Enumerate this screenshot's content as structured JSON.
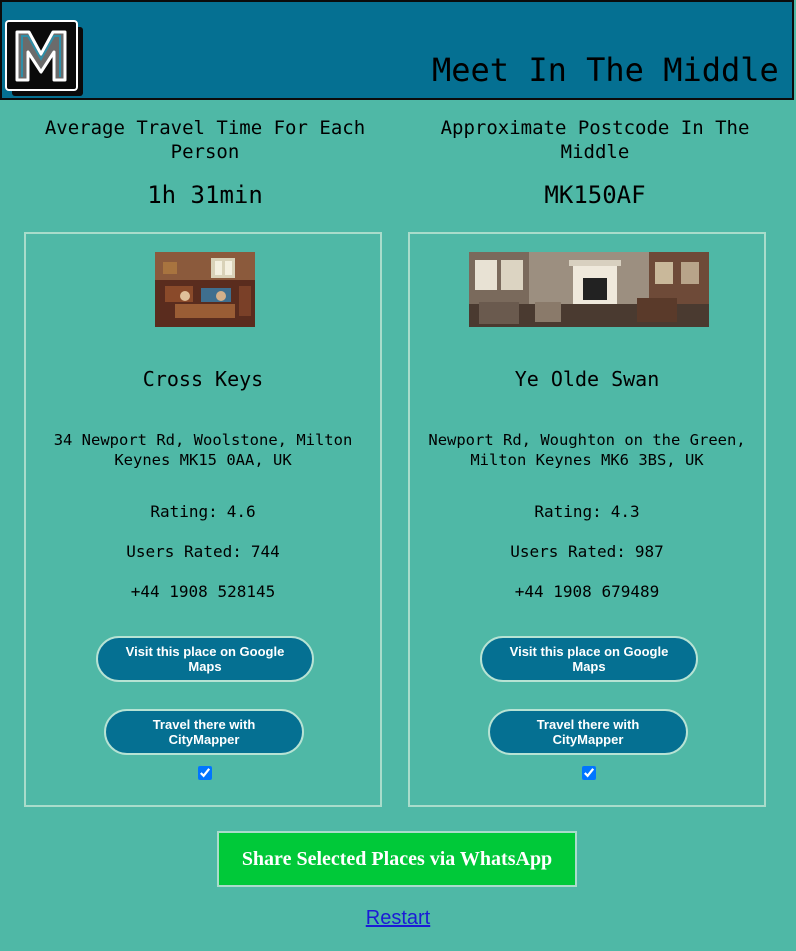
{
  "header": {
    "logo_letter": "M",
    "title": "Meet In The Middle"
  },
  "summary": {
    "avg_time_label": "Average Travel Time For Each Person",
    "avg_time_value": "1h 31min",
    "postcode_label": "Approximate Postcode In The Middle",
    "postcode_value": "MK150AF"
  },
  "places": [
    {
      "name": "Cross Keys",
      "address": "34 Newport Rd, Woolstone, Milton Keynes MK15 0AA, UK",
      "rating_label": "Rating:",
      "rating": "4.6",
      "users_label": "Users Rated:",
      "users_rated": "744",
      "phone": "+44 1908 528145",
      "maps_button": "Visit this place on Google Maps",
      "citymapper_button": "Travel there with CityMapper",
      "selected": true
    },
    {
      "name": "Ye Olde Swan",
      "address": "Newport Rd, Woughton on the Green, Milton Keynes MK6 3BS, UK",
      "rating_label": "Rating:",
      "rating": "4.3",
      "users_label": "Users Rated:",
      "users_rated": "987",
      "phone": "+44 1908 679489",
      "maps_button": "Visit this place on Google Maps",
      "citymapper_button": "Travel there with CityMapper",
      "selected": true
    }
  ],
  "actions": {
    "share_label": "Share Selected Places via WhatsApp",
    "restart_label": "Restart"
  },
  "colors": {
    "background": "#4fb8a6",
    "header": "#057092",
    "button": "#057092",
    "share_button": "#00c939",
    "link": "#1b1bd6"
  }
}
